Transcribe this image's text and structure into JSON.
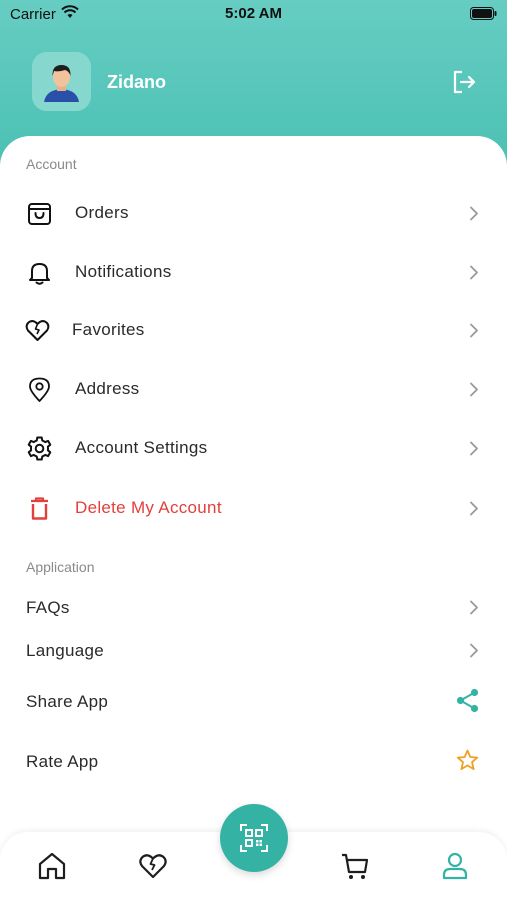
{
  "status_bar": {
    "carrier": "Carrier",
    "time": "5:02 AM"
  },
  "profile": {
    "name": "Zidano"
  },
  "account_section": {
    "title": "Account",
    "items": [
      {
        "label": "Orders",
        "icon": "bag-icon"
      },
      {
        "label": "Notifications",
        "icon": "bell-icon"
      },
      {
        "label": "Favorites",
        "icon": "heart-icon"
      },
      {
        "label": "Address",
        "icon": "location-pin-icon"
      },
      {
        "label": "Account Settings",
        "icon": "gear-icon"
      },
      {
        "label": "Delete My Account",
        "icon": "trash-icon"
      }
    ]
  },
  "application_section": {
    "title": "Application",
    "items": [
      {
        "label": "FAQs"
      },
      {
        "label": "Language"
      },
      {
        "label": "Share App",
        "icon": "share-icon"
      },
      {
        "label": "Rate App",
        "icon": "star-icon"
      }
    ]
  },
  "bottom_nav": {
    "items": [
      "home-icon",
      "heart-icon",
      "qr-code-icon",
      "cart-icon",
      "profile-icon"
    ],
    "active": "profile-icon"
  },
  "colors": {
    "accent": "#34b3a4",
    "danger": "#e2403d",
    "star": "#f0a020"
  }
}
